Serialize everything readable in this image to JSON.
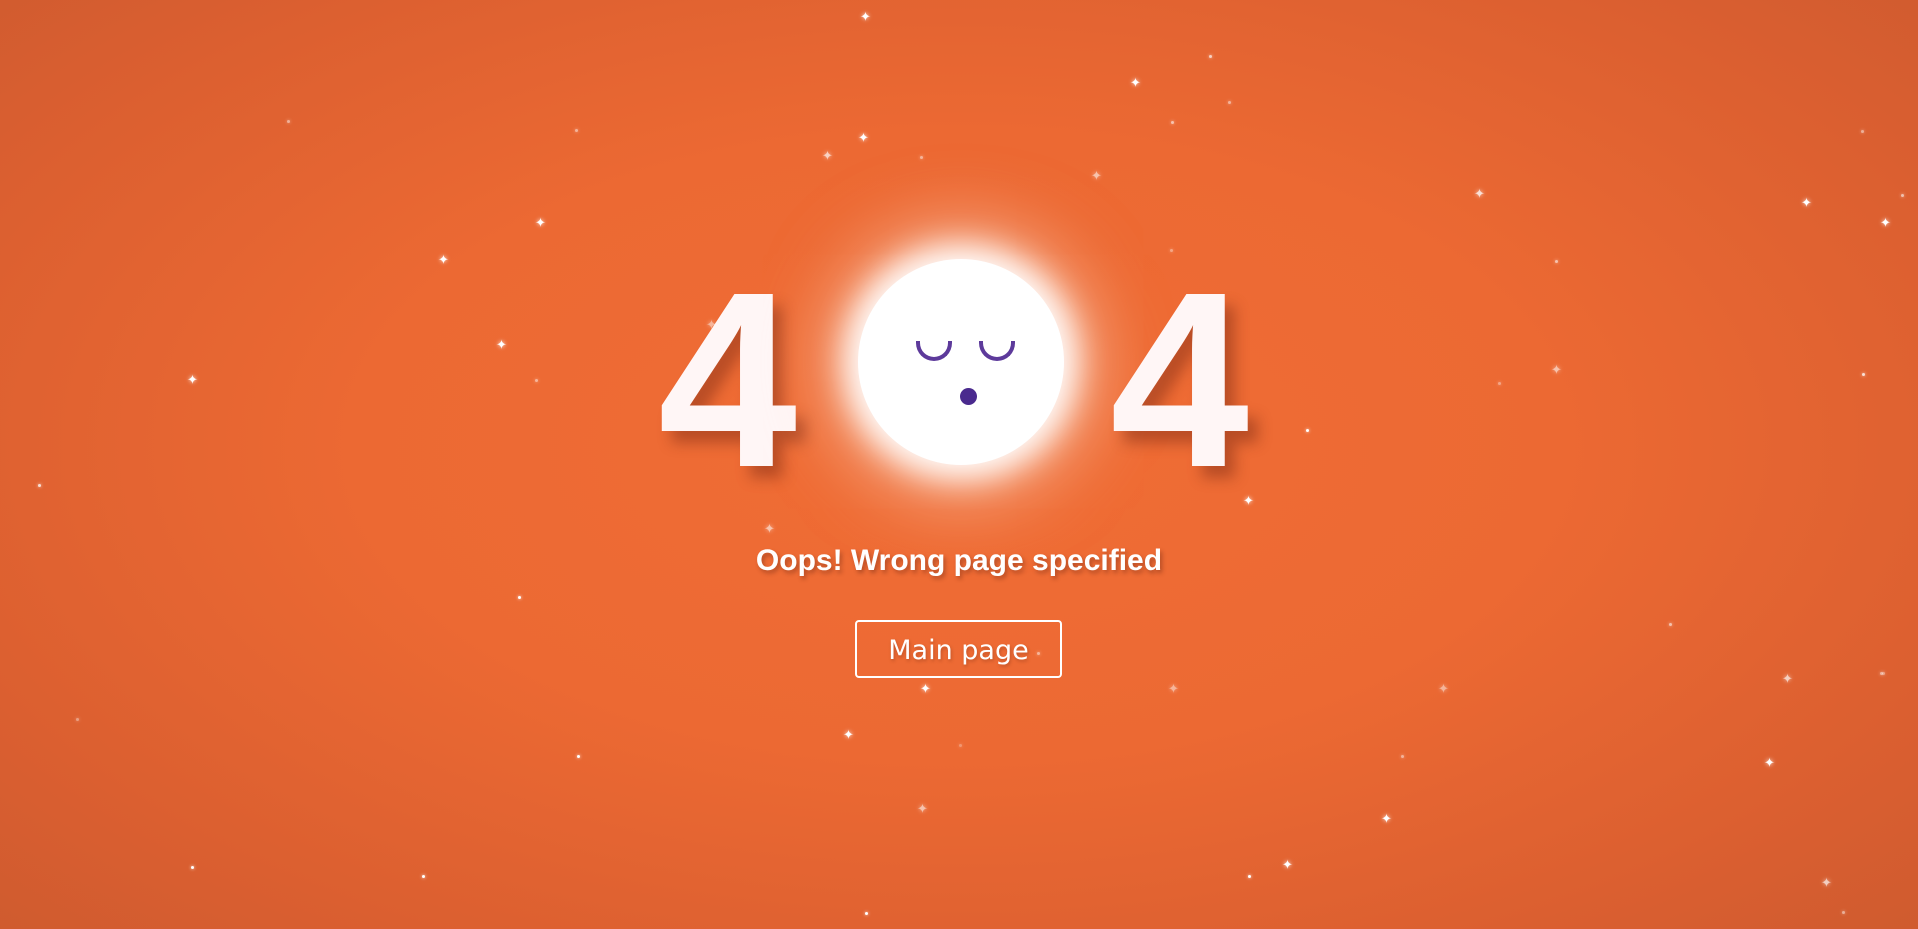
{
  "error_code": {
    "first_digit": "4",
    "last_digit": "4"
  },
  "mascot": {
    "icon": "sleeping-moon-face-icon",
    "eye_color": "#5d3a9b"
  },
  "message": "Oops! Wrong page specified",
  "main_button_label": "Main page",
  "colors": {
    "background": "#ec6933",
    "text": "#ffffff"
  }
}
